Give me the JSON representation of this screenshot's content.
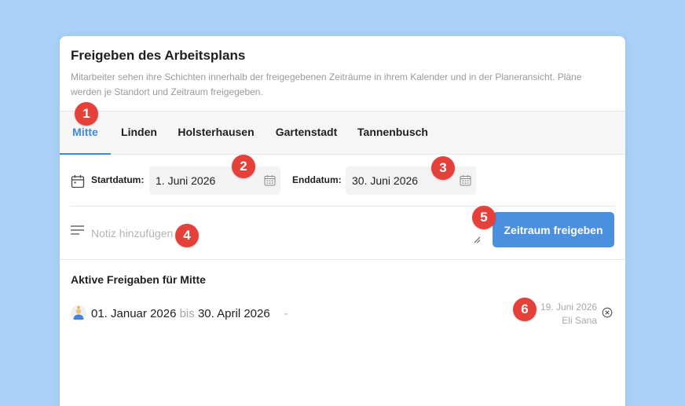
{
  "dialog": {
    "title": "Freigeben des Arbeitsplans",
    "description": "Mitarbeiter sehen ihre Schichten innerhalb der freigegebenen Zeiträume in ihrem Kalender und in der Planeransicht. Pläne werden je Standort und Zeitraum freigegeben."
  },
  "tabs": [
    {
      "label": "Mitte",
      "active": true
    },
    {
      "label": "Linden",
      "active": false
    },
    {
      "label": "Holsterhausen",
      "active": false
    },
    {
      "label": "Gartenstadt",
      "active": false
    },
    {
      "label": "Tannenbusch",
      "active": false
    }
  ],
  "dates": {
    "start_label": "Startdatum:",
    "start_value": "1. Juni 2026",
    "end_label": "Enddatum:",
    "end_value": "30. Juni 2026"
  },
  "note": {
    "placeholder": "Notiz hinzufügen",
    "value": ""
  },
  "submit_label": "Zeitraum freigeben",
  "active_releases": {
    "title": "Aktive Freigaben für Mitte",
    "items": [
      {
        "start": "01. Januar 2026",
        "connector": "bis",
        "end": "30. April 2026",
        "note": "-",
        "created_date": "19. Juni 2026",
        "created_by": "Eli Sana"
      }
    ]
  },
  "markers": [
    "1",
    "2",
    "3",
    "4",
    "5",
    "6"
  ],
  "colors": {
    "background": "#a9d0f7",
    "accent": "#4a90df",
    "active_tab": "#3f86de",
    "marker": "#e5403a"
  },
  "icons": {
    "start_date": "calendar-icon",
    "date_picker": "calendar-icon",
    "note": "text-lines-icon",
    "remove": "close-circle-icon",
    "avatar": "user-avatar"
  }
}
